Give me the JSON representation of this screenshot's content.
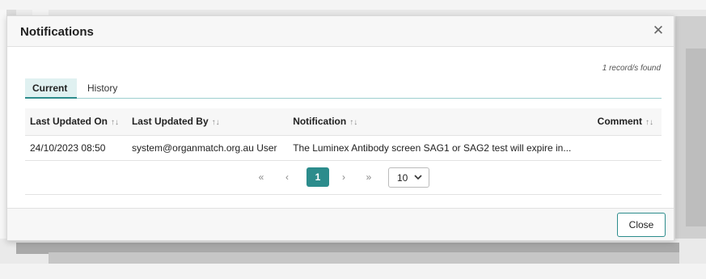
{
  "modal": {
    "title": "Notifications",
    "close_icon": "close-icon"
  },
  "records_found": "1 record/s found",
  "tabs": [
    {
      "label": "Current",
      "active": true
    },
    {
      "label": "History",
      "active": false
    }
  ],
  "table": {
    "columns": [
      {
        "label": "Last Updated On",
        "sort": "↑↓"
      },
      {
        "label": "Last Updated By",
        "sort": "↑↓"
      },
      {
        "label": "Notification",
        "sort": "↑↓"
      },
      {
        "label": "Comment",
        "sort": "↑↓"
      }
    ],
    "rows": [
      {
        "last_updated_on": "24/10/2023 08:50",
        "last_updated_by": "system@organmatch.org.au User",
        "notification": "The Luminex Antibody screen SAG1 or SAG2 test will expire in...",
        "comment": ""
      }
    ]
  },
  "pagination": {
    "first": "«",
    "prev": "‹",
    "current_page": "1",
    "next": "›",
    "last": "»",
    "page_size": "10"
  },
  "footer": {
    "close_label": "Close"
  },
  "colors": {
    "accent": "#2c8c8c",
    "tab_active_bg": "#e0f1f1"
  }
}
